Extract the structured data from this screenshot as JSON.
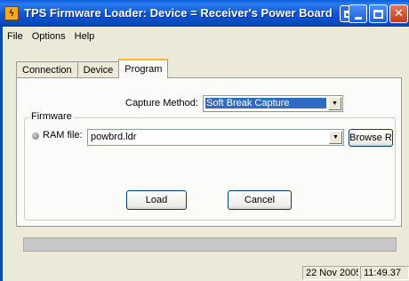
{
  "window": {
    "title": "TPS Firmware Loader:  Device = Receiver's Power Board",
    "app_icon": "lightning-icon"
  },
  "menu": {
    "file": "File",
    "options": "Options",
    "help": "Help"
  },
  "tabs": [
    {
      "label": "Connection"
    },
    {
      "label": "Device"
    },
    {
      "label": "Program"
    }
  ],
  "capture": {
    "label": "Capture Method:",
    "value": "Soft Break Capture"
  },
  "firmware": {
    "legend": "Firmware",
    "ram_label": "RAM file:",
    "ram_value": "powbrd.ldr",
    "browse_label": "Browse R",
    "load_label": "Load",
    "cancel_label": "Cancel"
  },
  "progress": {
    "value": 0
  },
  "status": {
    "date": "22 Nov 2005",
    "time": "11:49.37"
  }
}
